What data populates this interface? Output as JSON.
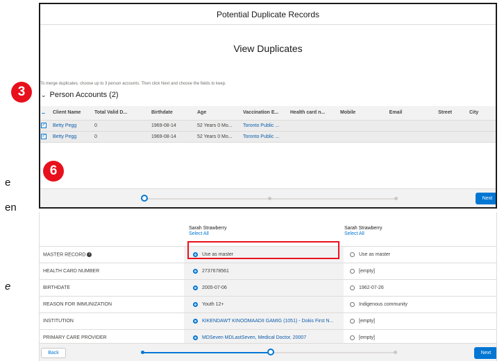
{
  "document_fragments": [
    "e",
    "en",
    "e"
  ],
  "markers": [
    "3",
    "6"
  ],
  "top_panel": {
    "title": "Potential Duplicate Records",
    "subtitle": "View Duplicates",
    "instruction": "To merge duplicates, choose up to 3 person accounts. Then click Next and choose the fields to keep.",
    "section_label": "Person Accounts (2)",
    "columns": [
      "Client Name",
      "Total Valid D...",
      "Birthdate",
      "Age",
      "Vaccination E...",
      "Health card n...",
      "Mobile",
      "Email",
      "Street",
      "City"
    ],
    "rows": [
      [
        "Betty Pegg",
        "0",
        "1969-08-14",
        "52 Years 0 Mo...",
        "Toronto Public ..."
      ],
      [
        "Betty Pegg",
        "0",
        "1969-08-14",
        "52 Years 0 Mo...",
        "Toronto Public ..."
      ]
    ],
    "next_label": "Next"
  },
  "bottom_panel": {
    "columns": [
      {
        "name": "Sarah Strawberry",
        "select_all": "Select All"
      },
      {
        "name": "Sarah Strawberry",
        "select_all": "Select All"
      }
    ],
    "fields": [
      {
        "label": "MASTER RECORD",
        "left": "Use as master",
        "right": "Use as master"
      },
      {
        "label": "HEALTH CARD NUMBER",
        "left": "2737678561",
        "right": "[empty]"
      },
      {
        "label": "BIRTHDATE",
        "left": "2005-07-06",
        "right": "1962-07-26"
      },
      {
        "label": "REASON FOR IMMUNIZATION",
        "left": "Youth 12+",
        "right": "Indigenous community"
      },
      {
        "label": "INSTITUTION",
        "left": "KIKENDAWT KINOOMAADII GAMIG (1051) - Dokis First N...",
        "right": "[empty]"
      },
      {
        "label": "PRIMARY CARE PROVIDER",
        "left": "MDSeven MDLastSeven, Medical Doctor, 20007",
        "right": "[empty]"
      }
    ],
    "back_label": "Back",
    "next_label": "Next"
  }
}
